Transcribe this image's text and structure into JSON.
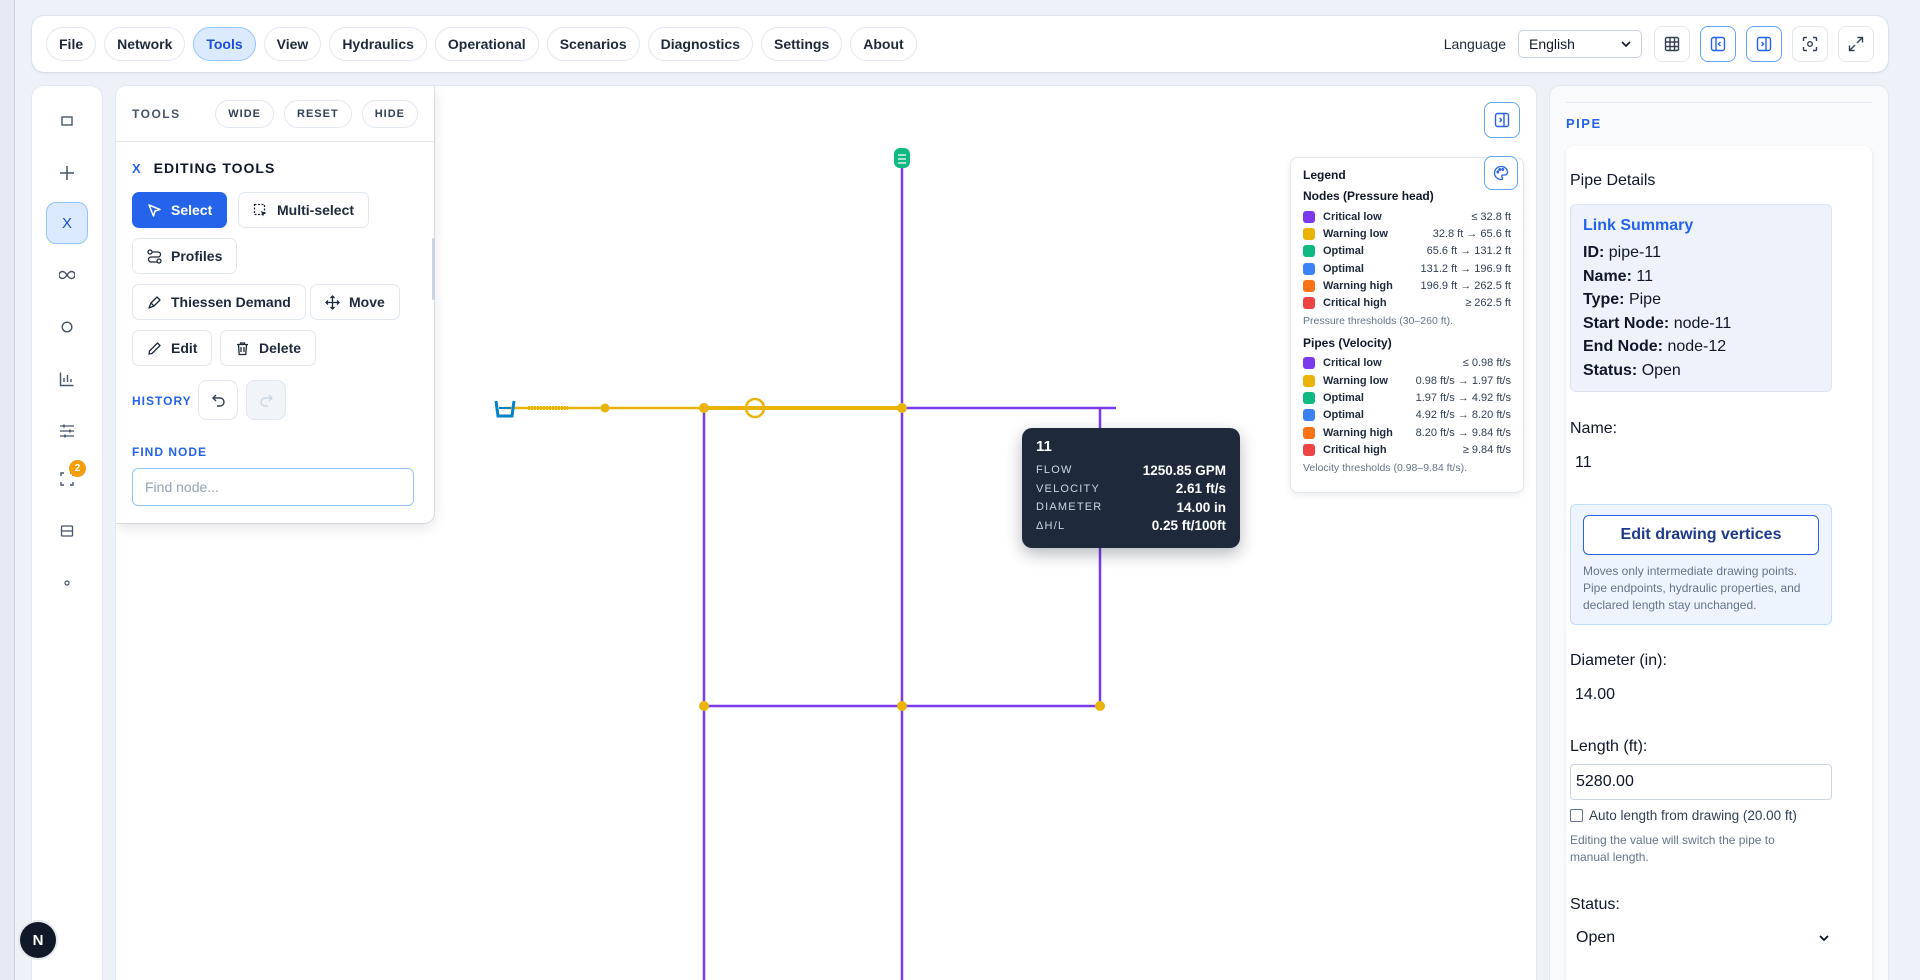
{
  "menu": {
    "items": [
      "File",
      "Network",
      "Tools",
      "View",
      "Hydraulics",
      "Operational",
      "Scenarios",
      "Diagnostics",
      "Settings",
      "About"
    ],
    "active": "Tools",
    "language_label": "Language",
    "language_value": "English"
  },
  "rail": {
    "active_label": "X",
    "badge": "2"
  },
  "tools": {
    "title": "TOOLS",
    "wide": "WIDE",
    "reset": "RESET",
    "hide": "HIDE",
    "close_x": "X",
    "section": "EDITING TOOLS",
    "select": "Select",
    "multiselect": "Multi-select",
    "profiles": "Profiles",
    "thiessen": "Thiessen Demand",
    "move": "Move",
    "edit": "Edit",
    "delete": "Delete",
    "history": "HISTORY",
    "find_label": "FIND NODE",
    "find_placeholder": "Find node..."
  },
  "legend": {
    "title": "Legend",
    "nodes_title": "Nodes (Pressure head)",
    "nodes": [
      {
        "name": "Critical low",
        "range": "≤ 32.8 ft",
        "color": "#7c3aed"
      },
      {
        "name": "Warning low",
        "range": "32.8 ft → 65.6 ft",
        "color": "#eab308"
      },
      {
        "name": "Optimal",
        "range": "65.6 ft → 131.2 ft",
        "color": "#10b981"
      },
      {
        "name": "Optimal",
        "range": "131.2 ft → 196.9 ft",
        "color": "#3b82f6"
      },
      {
        "name": "Warning high",
        "range": "196.9 ft → 262.5 ft",
        "color": "#f97316"
      },
      {
        "name": "Critical high",
        "range": "≥ 262.5 ft",
        "color": "#ef4444"
      }
    ],
    "nodes_note": "Pressure thresholds (30–260 ft).",
    "pipes_title": "Pipes (Velocity)",
    "pipes": [
      {
        "name": "Critical low",
        "range": "≤ 0.98 ft/s",
        "color": "#7c3aed"
      },
      {
        "name": "Warning low",
        "range": "0.98 ft/s → 1.97 ft/s",
        "color": "#eab308"
      },
      {
        "name": "Optimal",
        "range": "1.97 ft/s → 4.92 ft/s",
        "color": "#10b981"
      },
      {
        "name": "Optimal",
        "range": "4.92 ft/s → 8.20 ft/s",
        "color": "#3b82f6"
      },
      {
        "name": "Warning high",
        "range": "8.20 ft/s → 9.84 ft/s",
        "color": "#f97316"
      },
      {
        "name": "Critical high",
        "range": "≥ 9.84 ft/s",
        "color": "#ef4444"
      }
    ],
    "pipes_note": "Velocity thresholds (0.98–9.84 ft/s)."
  },
  "tooltip": {
    "title": "11",
    "rows": [
      {
        "key": "FLOW",
        "value": "1250.85 GPM"
      },
      {
        "key": "VELOCITY",
        "value": "2.61 ft/s"
      },
      {
        "key": "DIAMETER",
        "value": "14.00 in"
      },
      {
        "key": "ΔH/L",
        "value": "0.25 ft/100ft"
      }
    ]
  },
  "panel": {
    "title": "PIPE",
    "heading": "Pipe Details",
    "summary_title": "Link Summary",
    "summary": [
      {
        "k": "ID:",
        "v": "pipe-11"
      },
      {
        "k": "Name:",
        "v": "11"
      },
      {
        "k": "Type:",
        "v": "Pipe"
      },
      {
        "k": "Start Node:",
        "v": "node-11"
      },
      {
        "k": "End Node:",
        "v": "node-12"
      },
      {
        "k": "Status:",
        "v": "Open"
      }
    ],
    "name_label": "Name:",
    "name_value": "11",
    "vertices_button": "Edit drawing vertices",
    "vertices_note": "Moves only intermediate drawing points. Pipe endpoints, hydraulic properties, and declared length stay unchanged.",
    "diameter_label": "Diameter (in):",
    "diameter_value": "14.00",
    "length_label": "Length (ft):",
    "length_value": "5280.00",
    "auto_length": "Auto length from drawing (20.00 ft)",
    "auto_note": "Editing the value will switch the pipe to manual length.",
    "status_label": "Status:",
    "status_value": "Open"
  },
  "user": {
    "avatar": "N"
  },
  "colors": {
    "accent": "#2563eb",
    "pipe_purple": "#7c3aed",
    "pipe_yellow": "#eab308",
    "tank_green": "#10b981",
    "reservoir_blue": "#0284c7"
  }
}
